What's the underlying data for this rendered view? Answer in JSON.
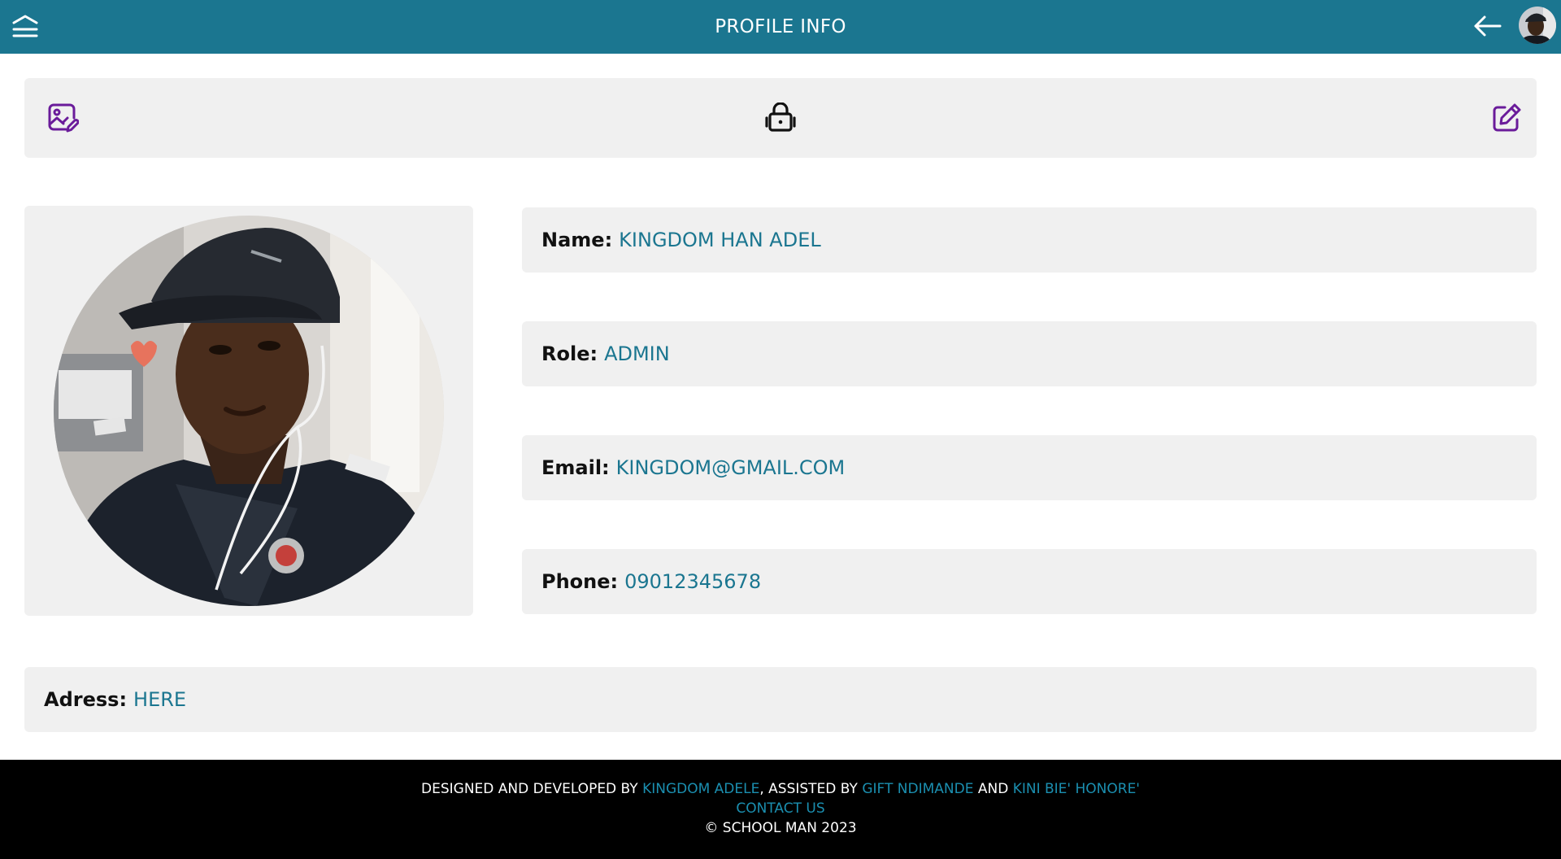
{
  "header": {
    "title": "PROFILE INFO",
    "menu_icon": "menu-icon",
    "back_icon": "arrow-left-icon",
    "avatar": "user-avatar"
  },
  "toolbar": {
    "change_photo_icon": "image-edit-icon",
    "change_password_icon": "lock-open-icon",
    "edit_profile_icon": "edit-icon"
  },
  "profile": {
    "name_label": "Name:",
    "name_value": "KINGDOM HAN ADEL",
    "role_label": "Role:",
    "role_value": "ADMIN",
    "email_label": "Email:",
    "email_value": "KINGDOM@GMAIL.COM",
    "phone_label": "Phone:",
    "phone_value": "09012345678",
    "address_label": "Adress:",
    "address_value": "HERE"
  },
  "footer": {
    "designed_prefix": "DESIGNED AND DEVELOPED BY ",
    "developer": "KINGDOM ADELE",
    "assisted_prefix": ", ASSISTED BY ",
    "assistant_1": "GIFT NDIMANDE",
    "and_text": " AND ",
    "assistant_2": "KINI BIE' HONORE'",
    "contact": "CONTACT US",
    "copyright": "© SCHOOL MAN 2023"
  },
  "colors": {
    "primary": "#1b7690",
    "card_bg": "#f0f0f0",
    "footer_bg": "#000000",
    "icon_purple": "#6a1b9a"
  }
}
